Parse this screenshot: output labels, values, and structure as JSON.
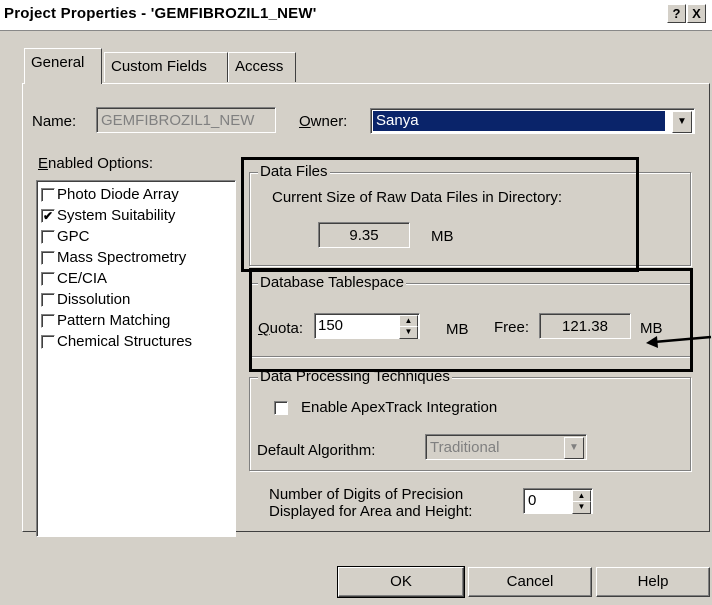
{
  "window": {
    "title": "Project Properties - 'GEMFIBROZIL1_NEW'",
    "help_button": "?",
    "close_button": "X"
  },
  "tabs": [
    {
      "label": "General",
      "active": true
    },
    {
      "label": "Custom Fields",
      "active": false
    },
    {
      "label": "Access",
      "active": false
    }
  ],
  "general": {
    "name_label": "Name:",
    "name_value": "GEMFIBROZIL1_NEW",
    "owner_label": "Owner:",
    "owner_value": "Sanya",
    "enabled_options_label": "Enabled Options:",
    "options": [
      {
        "label": "Photo Diode Array",
        "checked": false
      },
      {
        "label": "System Suitability",
        "checked": true
      },
      {
        "label": "GPC",
        "checked": false
      },
      {
        "label": "Mass Spectrometry",
        "checked": false
      },
      {
        "label": "CE/CIA",
        "checked": false
      },
      {
        "label": "Dissolution",
        "checked": false
      },
      {
        "label": "Pattern Matching",
        "checked": false
      },
      {
        "label": "Chemical Structures",
        "checked": false
      }
    ],
    "data_files": {
      "legend": "Data Files",
      "description": "Current Size of Raw Data Files in Directory:",
      "size_value": "9.35",
      "size_unit": "MB"
    },
    "tablespace": {
      "legend": "Database Tablespace",
      "quota_label": "Quota:",
      "quota_value": "150",
      "quota_unit": "MB",
      "free_label": "Free:",
      "free_value": "121.38",
      "free_unit": "MB"
    },
    "processing": {
      "legend": "Data Processing Techniques",
      "apextrack_label": "Enable ApexTrack Integration",
      "apextrack_checked": false,
      "algorithm_label": "Default Algorithm:",
      "algorithm_value": "Traditional"
    },
    "precision": {
      "label_line1": "Number of Digits of Precision",
      "label_line2": "Displayed for Area and Height:",
      "value": "0"
    }
  },
  "buttons": {
    "ok": "OK",
    "cancel": "Cancel",
    "help": "Help"
  },
  "colors": {
    "dialog_bg": "#d4d0c8",
    "annotation": "#000000"
  },
  "icons": {
    "check": "✔",
    "up": "▲",
    "down": "▼",
    "arrow": "arrow-pointer-icon"
  }
}
